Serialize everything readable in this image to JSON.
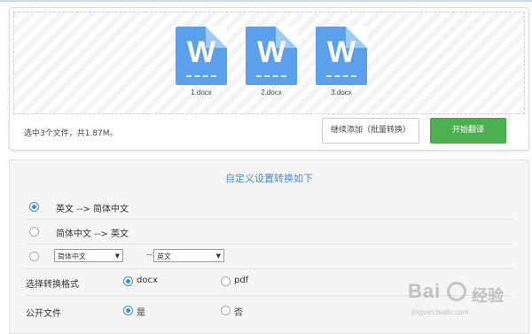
{
  "upload": {
    "files": [
      {
        "name": "1.docx",
        "icon": "word-doc-icon",
        "glyph": "W"
      },
      {
        "name": "2.docx",
        "icon": "word-doc-icon",
        "glyph": "W"
      },
      {
        "name": "3.docx",
        "icon": "word-doc-icon",
        "glyph": "W"
      }
    ],
    "status": "选中3个文件，共1.87M。",
    "continue_label": "继续添加（批量转换）",
    "start_label": "开始翻译"
  },
  "settings": {
    "title": "自定义设置转换如下",
    "options": [
      {
        "label": "英文 --> 简体中文",
        "selected": true
      },
      {
        "label": "简体中文 --> 英文",
        "selected": false
      }
    ],
    "custom": {
      "source_value": "简体中文",
      "arrow": "-->",
      "target_value": "英文"
    },
    "format": {
      "label": "选择转换格式",
      "choices": [
        {
          "label": "docx",
          "selected": true
        },
        {
          "label": "pdf",
          "selected": false
        }
      ]
    },
    "public": {
      "label": "公开文件",
      "choices": [
        {
          "label": "是",
          "selected": true
        },
        {
          "label": "否",
          "selected": false
        }
      ]
    }
  },
  "watermark": {
    "brand": "Bai",
    "cn": "经验",
    "url": "jingyan.baidu.com"
  },
  "colors": {
    "accent": "#3e8ed0",
    "start_button": "#4caf50",
    "file_icon": "#5aa0ea"
  }
}
